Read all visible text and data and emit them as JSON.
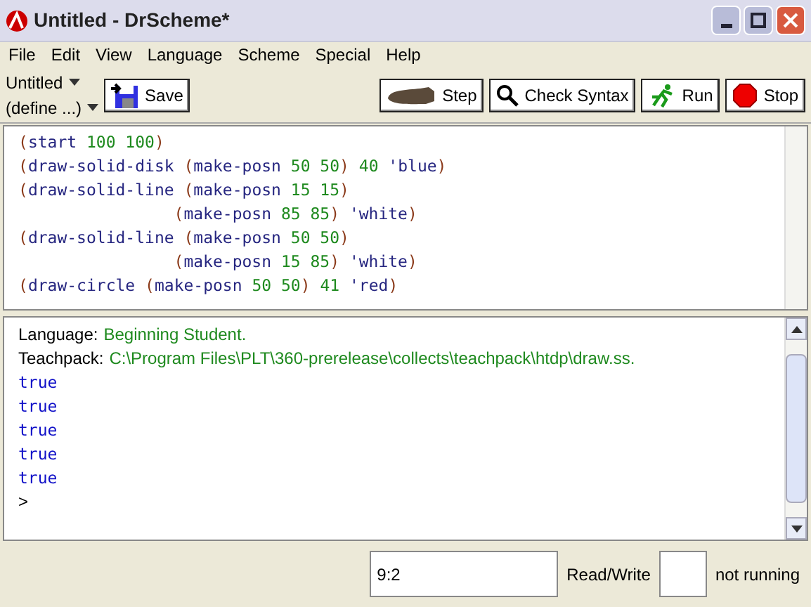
{
  "window": {
    "title": "Untitled - DrScheme*"
  },
  "menu": [
    "File",
    "Edit",
    "View",
    "Language",
    "Scheme",
    "Special",
    "Help"
  ],
  "toolbar": {
    "file_menu": "Untitled",
    "define_menu": "(define ...)",
    "left_buttons": [
      {
        "label": "Save",
        "kind": "save"
      }
    ],
    "right_buttons": [
      {
        "label": "Step",
        "kind": "step"
      },
      {
        "label": "Check Syntax",
        "kind": "check"
      },
      {
        "label": "Run",
        "kind": "run"
      },
      {
        "label": "Stop",
        "kind": "stop"
      }
    ]
  },
  "definitions": [
    [
      {
        "kind": "paren",
        "text": "("
      },
      {
        "kind": "id",
        "text": "start "
      },
      {
        "kind": "num",
        "text": "100 100"
      },
      {
        "kind": "paren",
        "text": ")"
      }
    ],
    [
      {
        "kind": "paren",
        "text": "("
      },
      {
        "kind": "id",
        "text": "draw-solid-disk "
      },
      {
        "kind": "paren",
        "text": "("
      },
      {
        "kind": "id",
        "text": "make-posn "
      },
      {
        "kind": "num",
        "text": "50 50"
      },
      {
        "kind": "paren",
        "text": ")"
      },
      {
        "kind": "num",
        "text": " 40 "
      },
      {
        "kind": "id",
        "text": "'blue"
      },
      {
        "kind": "paren",
        "text": ")"
      }
    ],
    [
      {
        "kind": "paren",
        "text": "("
      },
      {
        "kind": "id",
        "text": "draw-solid-line "
      },
      {
        "kind": "paren",
        "text": "("
      },
      {
        "kind": "id",
        "text": "make-posn "
      },
      {
        "kind": "num",
        "text": "15 15"
      },
      {
        "kind": "paren",
        "text": ")"
      }
    ],
    [
      {
        "kind": "paren",
        "text": "                ("
      },
      {
        "kind": "id",
        "text": "make-posn "
      },
      {
        "kind": "num",
        "text": "85 85"
      },
      {
        "kind": "paren",
        "text": ")"
      },
      {
        "kind": "id",
        "text": " 'white"
      },
      {
        "kind": "paren",
        "text": ")"
      }
    ],
    [
      {
        "kind": "paren",
        "text": "("
      },
      {
        "kind": "id",
        "text": "draw-solid-line "
      },
      {
        "kind": "paren",
        "text": "("
      },
      {
        "kind": "id",
        "text": "make-posn "
      },
      {
        "kind": "num",
        "text": "50 50"
      },
      {
        "kind": "paren",
        "text": ")"
      }
    ],
    [
      {
        "kind": "paren",
        "text": "                ("
      },
      {
        "kind": "id",
        "text": "make-posn "
      },
      {
        "kind": "num",
        "text": "15 85"
      },
      {
        "kind": "paren",
        "text": ")"
      },
      {
        "kind": "id",
        "text": " 'white"
      },
      {
        "kind": "paren",
        "text": ")"
      }
    ],
    [
      {
        "kind": "paren",
        "text": "("
      },
      {
        "kind": "id",
        "text": "draw-circle "
      },
      {
        "kind": "paren",
        "text": "("
      },
      {
        "kind": "id",
        "text": "make-posn "
      },
      {
        "kind": "num",
        "text": "50 50"
      },
      {
        "kind": "paren",
        "text": ")"
      },
      {
        "kind": "num",
        "text": " 41 "
      },
      {
        "kind": "id",
        "text": "'red"
      },
      {
        "kind": "paren",
        "text": ")"
      }
    ]
  ],
  "interactions": {
    "info": [
      {
        "label": "Language:",
        "value": "Beginning Student."
      },
      {
        "label": "Teachpack:",
        "value": "C:\\Program Files\\PLT\\360-prerelease\\collects\\teachpack\\htdp\\draw.ss."
      }
    ],
    "results": [
      "true",
      "true",
      "true",
      "true",
      "true"
    ],
    "prompt": ">"
  },
  "status_bar": {
    "position": "9:2",
    "mode": "Read/Write",
    "state": "not running"
  }
}
